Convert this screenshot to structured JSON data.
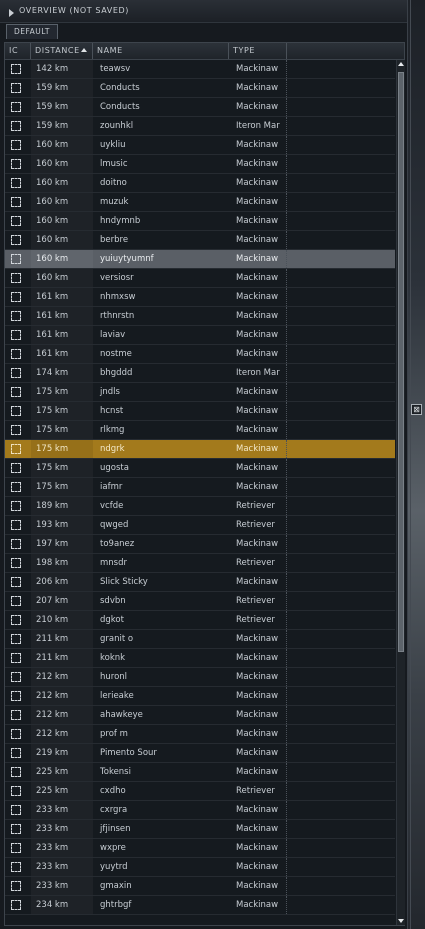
{
  "window": {
    "title": "OVERVIEW (NOT SAVED)",
    "tab_label": "DEFAULT"
  },
  "columns": {
    "icon": "IC",
    "distance": "DISTANCE",
    "name": "NAME",
    "type": "TYPE"
  },
  "side_handle_icon": "window-handle-icon",
  "colors": {
    "selected_row": "#5a5f66",
    "locked_row": "#a37a1c"
  },
  "rows": [
    {
      "distance": "142 km",
      "name": "teawsv",
      "type": "Mackinaw"
    },
    {
      "distance": "159 km",
      "name": "Conducts",
      "type": "Mackinaw"
    },
    {
      "distance": "159 km",
      "name": "Conducts",
      "type": "Mackinaw"
    },
    {
      "distance": "159 km",
      "name": "zounhkl",
      "type": "Iteron Mar"
    },
    {
      "distance": "160 km",
      "name": "uykliu",
      "type": "Mackinaw"
    },
    {
      "distance": "160 km",
      "name": "lmusic",
      "type": "Mackinaw"
    },
    {
      "distance": "160 km",
      "name": "doitno",
      "type": "Mackinaw"
    },
    {
      "distance": "160 km",
      "name": "muzuk",
      "type": "Mackinaw"
    },
    {
      "distance": "160 km",
      "name": "hndymnb",
      "type": "Mackinaw"
    },
    {
      "distance": "160 km",
      "name": "berbre",
      "type": "Mackinaw"
    },
    {
      "distance": "160 km",
      "name": "yuiuytyumnf",
      "type": "Mackinaw",
      "state": "selected"
    },
    {
      "distance": "160 km",
      "name": "versiosr",
      "type": "Mackinaw"
    },
    {
      "distance": "161 km",
      "name": "nhmxsw",
      "type": "Mackinaw"
    },
    {
      "distance": "161 km",
      "name": "rthnrstn",
      "type": "Mackinaw"
    },
    {
      "distance": "161 km",
      "name": "laviav",
      "type": "Mackinaw"
    },
    {
      "distance": "161 km",
      "name": "nostme",
      "type": "Mackinaw"
    },
    {
      "distance": "174 km",
      "name": "bhgddd",
      "type": "Iteron Mar"
    },
    {
      "distance": "175 km",
      "name": "jndls",
      "type": "Mackinaw"
    },
    {
      "distance": "175 km",
      "name": "hcnst",
      "type": "Mackinaw"
    },
    {
      "distance": "175 km",
      "name": "rlkmg",
      "type": "Mackinaw"
    },
    {
      "distance": "175 km",
      "name": "ndgrk",
      "type": "Mackinaw",
      "state": "locked"
    },
    {
      "distance": "175 km",
      "name": "ugosta",
      "type": "Mackinaw"
    },
    {
      "distance": "175 km",
      "name": "iafmr",
      "type": "Mackinaw"
    },
    {
      "distance": "189 km",
      "name": "vcfde",
      "type": "Retriever"
    },
    {
      "distance": "193 km",
      "name": "qwged",
      "type": "Retriever"
    },
    {
      "distance": "197 km",
      "name": "to9anez",
      "type": "Mackinaw"
    },
    {
      "distance": "198 km",
      "name": "mnsdr",
      "type": "Retriever"
    },
    {
      "distance": "206 km",
      "name": "Slick Sticky",
      "type": "Mackinaw"
    },
    {
      "distance": "207 km",
      "name": "sdvbn",
      "type": "Retriever"
    },
    {
      "distance": "210 km",
      "name": "dgkot",
      "type": "Retriever"
    },
    {
      "distance": "211 km",
      "name": "granit o",
      "type": "Mackinaw"
    },
    {
      "distance": "211 km",
      "name": "koknk",
      "type": "Mackinaw"
    },
    {
      "distance": "212 km",
      "name": "huronl",
      "type": "Mackinaw"
    },
    {
      "distance": "212 km",
      "name": "lerieake",
      "type": "Mackinaw"
    },
    {
      "distance": "212 km",
      "name": "ahawkeye",
      "type": "Mackinaw"
    },
    {
      "distance": "212 km",
      "name": "prof m",
      "type": "Mackinaw"
    },
    {
      "distance": "219 km",
      "name": "Pimento Sour",
      "type": "Mackinaw"
    },
    {
      "distance": "225 km",
      "name": "Tokensi",
      "type": "Mackinaw"
    },
    {
      "distance": "225 km",
      "name": "cxdho",
      "type": "Retriever"
    },
    {
      "distance": "233 km",
      "name": "cxrgra",
      "type": "Mackinaw"
    },
    {
      "distance": "233 km",
      "name": "jfjinsen",
      "type": "Mackinaw"
    },
    {
      "distance": "233 km",
      "name": "wxpre",
      "type": "Mackinaw"
    },
    {
      "distance": "233 km",
      "name": "yuytrd",
      "type": "Mackinaw"
    },
    {
      "distance": "233 km",
      "name": "gmaxin",
      "type": "Mackinaw"
    },
    {
      "distance": "234 km",
      "name": "ghtrbgf",
      "type": "Mackinaw"
    }
  ]
}
